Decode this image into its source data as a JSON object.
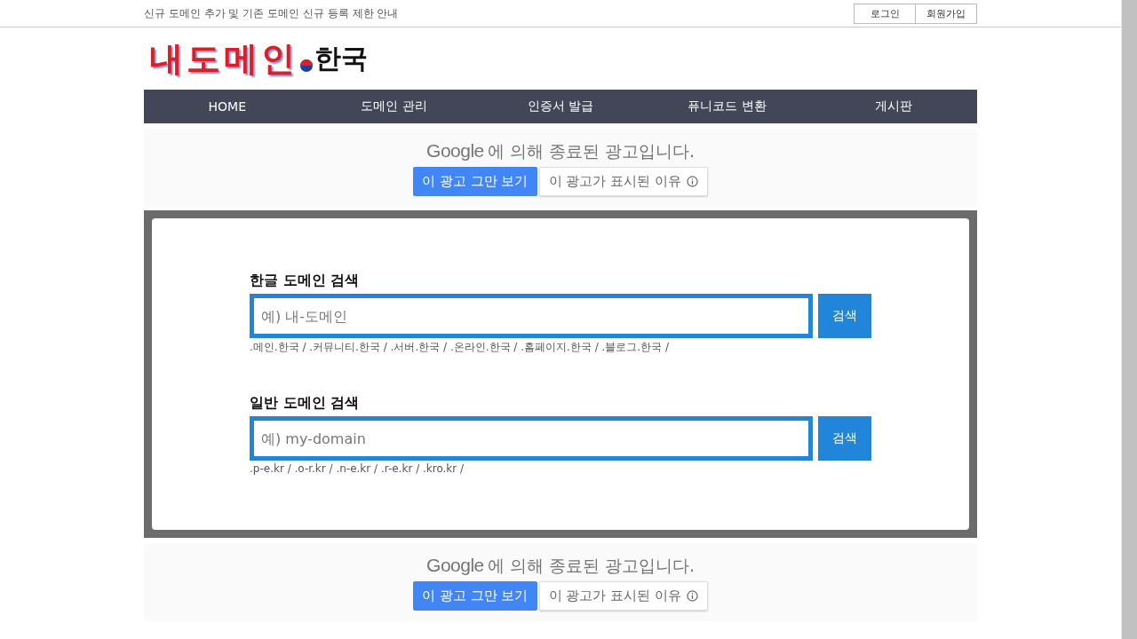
{
  "top_bar": {
    "notice": "신규 도메인 추가 및 기존 도메인 신규 등록 제한 안내",
    "links": [
      "로그인",
      "회원가입"
    ]
  },
  "logo": {
    "main": "내도메인",
    "suffix": "한국"
  },
  "nav": [
    "HOME",
    "도메인 관리",
    "인증서 발급",
    "퓨니코드 변환",
    "게시판"
  ],
  "ads": [
    {
      "brand": "Google",
      "message": "에 의해 종료된 광고입니다.",
      "stop_button": "이 광고 그만 보기",
      "why_button": "이 광고가 표시된 이유"
    },
    {
      "brand": "Google",
      "message": "에 의해 종료된 광고입니다.",
      "stop_button": "이 광고 그만 보기",
      "why_button": "이 광고가 표시된 이유"
    }
  ],
  "searches": [
    {
      "title": "한글 도메인 검색",
      "placeholder": "예) 내-도메인",
      "button": "검색",
      "suffixes": ".메인.한국 / .커뮤니티.한국 / .서버.한국 / .온라인.한국 / .홈페이지.한국 / .블로그.한국 /"
    },
    {
      "title": "일반 도메인 검색",
      "placeholder": "예) my-domain",
      "button": "검색",
      "suffixes": ".p-e.kr / .o-r.kr / .n-e.kr / .r-e.kr / .kro.kr /"
    }
  ]
}
